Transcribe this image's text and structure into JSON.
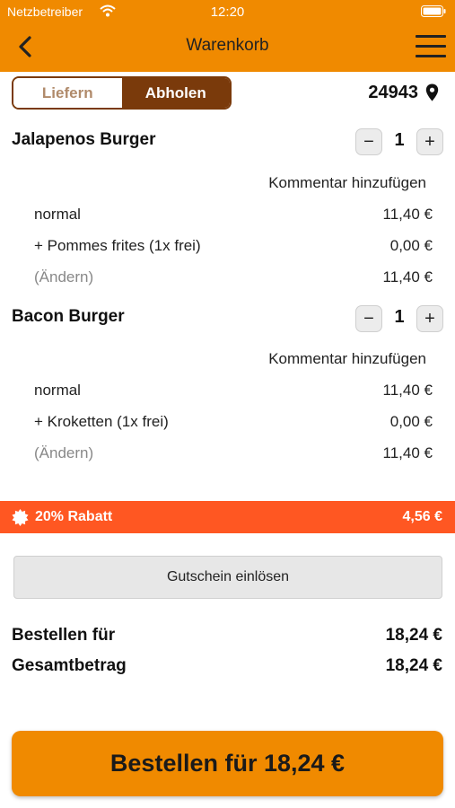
{
  "status_bar": {
    "carrier": "Netzbetreiber",
    "time": "12:20"
  },
  "nav": {
    "title": "Warenkorb"
  },
  "mode_toggle": {
    "deliver_label": "Liefern",
    "pickup_label": "Abholen",
    "selected": "Abholen"
  },
  "location": {
    "zip": "24943"
  },
  "cart_items": [
    {
      "name": "Jalapenos Burger",
      "quantity": "1",
      "comment_label": "Kommentar hinzufügen",
      "variant": "normal",
      "variant_price": "11,40 €",
      "side": "+ Pommes frites (1x frei)",
      "side_price": "0,00 €",
      "change_label": "(Ändern)",
      "total": "11,40 €"
    },
    {
      "name": "Bacon Burger",
      "quantity": "1",
      "comment_label": "Kommentar hinzufügen",
      "variant": "normal",
      "variant_price": "11,40 €",
      "side": "+ Kroketten (1x frei)",
      "side_price": "0,00 €",
      "change_label": "(Ändern)",
      "total": "11,40 €"
    }
  ],
  "discount": {
    "label": "20% Rabatt",
    "value": "4,56 €"
  },
  "voucher": {
    "label": "Gutschein einlösen"
  },
  "summary": {
    "order_for_label": "Bestellen für",
    "order_for_value": "18,24 €",
    "total_label": "Gesamtbetrag",
    "total_value": "18,24 €"
  },
  "order_button": {
    "label": "Bestellen für 18,24 €"
  },
  "colors": {
    "header": "#f08a00",
    "toggle_active": "#7a3a0b",
    "discount_bar": "#ff5722",
    "order_button": "#f08a00"
  },
  "icons": {
    "wifi": "wifi-icon",
    "battery": "battery-icon",
    "back": "chevron-left-icon",
    "menu": "hamburger-menu-icon",
    "location": "map-pin-icon",
    "discount": "badge-icon",
    "minus": "minus-icon",
    "plus": "plus-icon"
  }
}
